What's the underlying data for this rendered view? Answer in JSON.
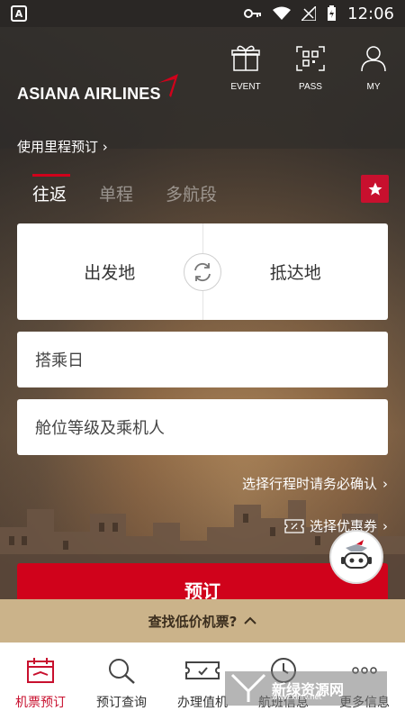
{
  "statusbar": {
    "time": "12:06"
  },
  "header": {
    "brand": "ASIANA AIRLINES",
    "event_label": "EVENT",
    "pass_label": "PASS",
    "my_label": "MY",
    "mileage_link": "使用里程预订"
  },
  "tabs": [
    {
      "label": "往返",
      "active": true
    },
    {
      "label": "单程",
      "active": false
    },
    {
      "label": "多航段",
      "active": false
    }
  ],
  "route": {
    "origin_placeholder": "出发地",
    "destination_placeholder": "抵达地"
  },
  "fields": {
    "date_placeholder": "搭乘日",
    "class_placeholder": "舱位等级及乘机人"
  },
  "links": {
    "confirm_itinerary": "选择行程时请务必确认",
    "coupon": "选择优惠券"
  },
  "book_button": "预订",
  "lowfare": "查找低价机票?",
  "bottom_nav": [
    {
      "label": "机票预订",
      "icon": "calendar-icon",
      "active": true
    },
    {
      "label": "预订查询",
      "icon": "search-icon",
      "active": false
    },
    {
      "label": "办理值机",
      "icon": "ticket-icon",
      "active": false
    },
    {
      "label": "航班信息",
      "icon": "clock-icon",
      "active": false
    },
    {
      "label": "更多信息",
      "icon": "more-icon",
      "active": false
    }
  ],
  "watermark": {
    "title": "新绿资源网",
    "subtitle": "www.xinlv.net"
  },
  "colors": {
    "brand_red": "#d0021b",
    "lowfare_bar": "#cbb38a"
  }
}
